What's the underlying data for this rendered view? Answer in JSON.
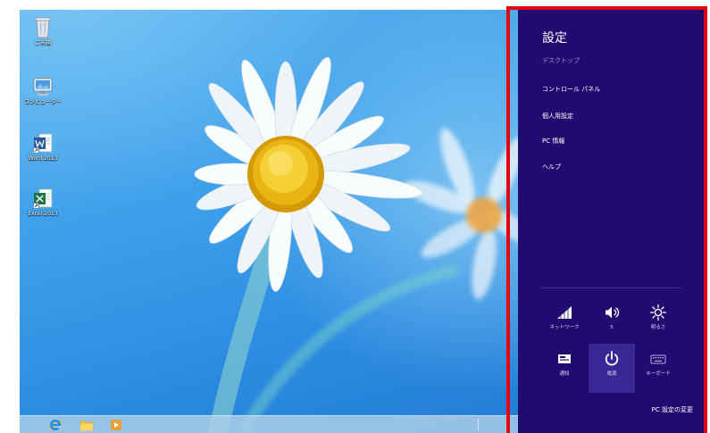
{
  "desktop": {
    "icons": [
      {
        "label": "ごみ箱",
        "icon": "recycle-bin-icon"
      },
      {
        "label": "コンピューター",
        "icon": "computer-icon"
      },
      {
        "label": "Word 2013",
        "icon": "word-icon"
      },
      {
        "label": "Excel 2013",
        "icon": "excel-icon"
      }
    ]
  },
  "taskbar": {
    "pinned": [
      {
        "icon": "internet-explorer-icon"
      },
      {
        "icon": "file-explorer-icon"
      },
      {
        "icon": "media-player-icon"
      }
    ]
  },
  "settings_charm": {
    "title": "設定",
    "context": "デスクトップ",
    "links": [
      {
        "label": "コントロール パネル"
      },
      {
        "label": "個人用設定"
      },
      {
        "label": "PC 情報"
      },
      {
        "label": "ヘルプ"
      }
    ],
    "quick_settings": [
      {
        "label": "ネットワーク",
        "icon": "network-signal-icon"
      },
      {
        "label": "5",
        "icon": "volume-icon"
      },
      {
        "label": "明るさ",
        "icon": "brightness-icon"
      },
      {
        "label": "通知",
        "icon": "notifications-icon"
      },
      {
        "label": "電源",
        "icon": "power-icon",
        "selected": true
      },
      {
        "label": "キーボード",
        "icon": "keyboard-icon"
      }
    ],
    "footer_link": "PC 設定の変更"
  },
  "colors": {
    "charm_background": "#220b70",
    "selected_tile": "#3a2795",
    "highlight_frame": "#e3000f"
  }
}
